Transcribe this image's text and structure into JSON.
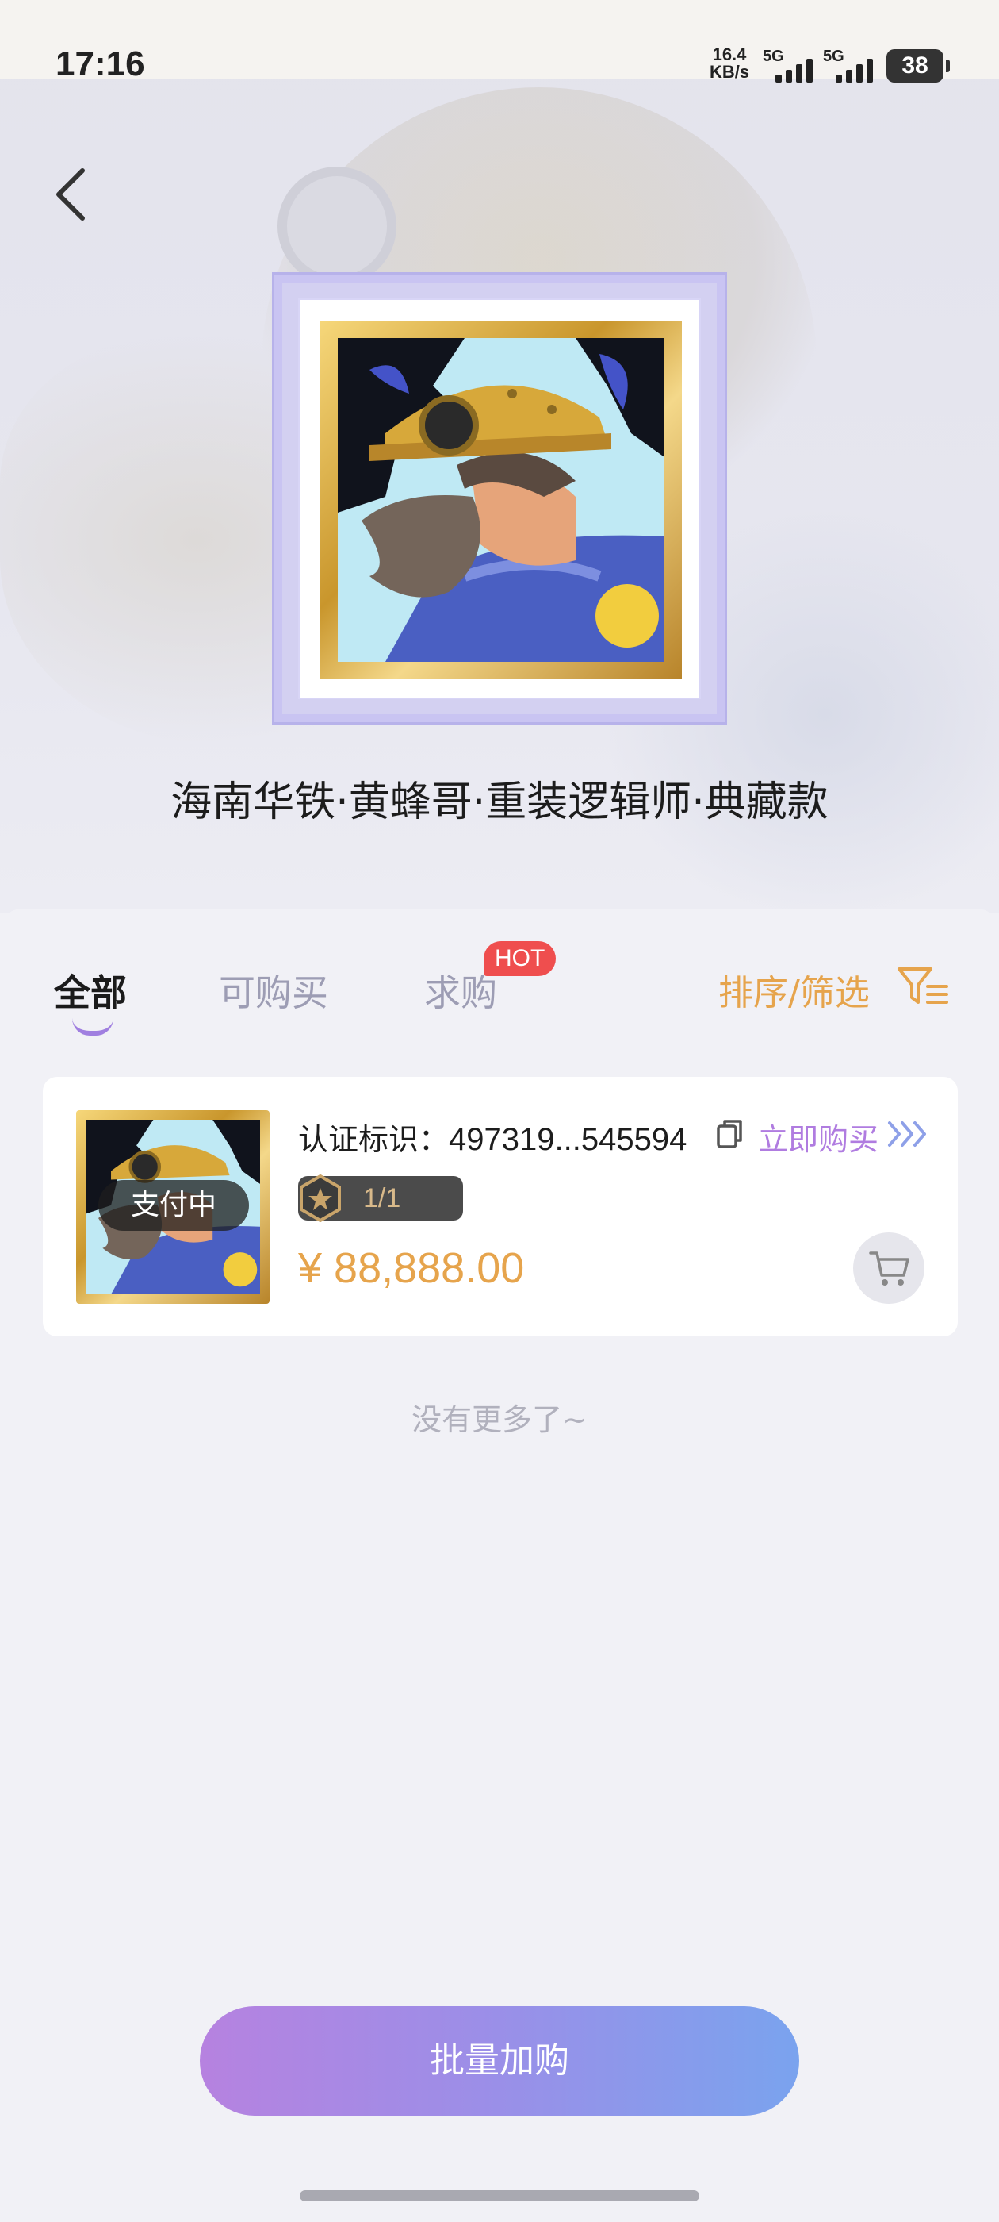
{
  "status_bar": {
    "time": "17:16",
    "net_speed_value": "16.4",
    "net_speed_unit": "KB/s",
    "signal1_label": "5G",
    "signal2_label": "5G",
    "battery": "38"
  },
  "collection": {
    "title": "海南华铁·黄蜂哥·重装逻辑师·典藏款"
  },
  "tabs": [
    {
      "label": "全部",
      "active": true
    },
    {
      "label": "可购买",
      "active": false
    },
    {
      "label": "求购",
      "active": false,
      "badge": "HOT"
    }
  ],
  "sort_filter_label": "排序/筛选",
  "items": [
    {
      "cert_label": "认证标识：",
      "cert_value": "497319...545594",
      "buy_now_label": "立即购买",
      "status": "支付中",
      "edition": "1/1",
      "price": "¥ 88,888.00"
    }
  ],
  "no_more_text": "没有更多了~",
  "bulk_button_label": "批量加购",
  "colors": {
    "accent_orange": "#e6a44c",
    "accent_purple": "#b07ce0",
    "hot_red": "#ef4e4e",
    "button_gradient_start": "#b682e0",
    "button_gradient_end": "#7aa3ee"
  }
}
